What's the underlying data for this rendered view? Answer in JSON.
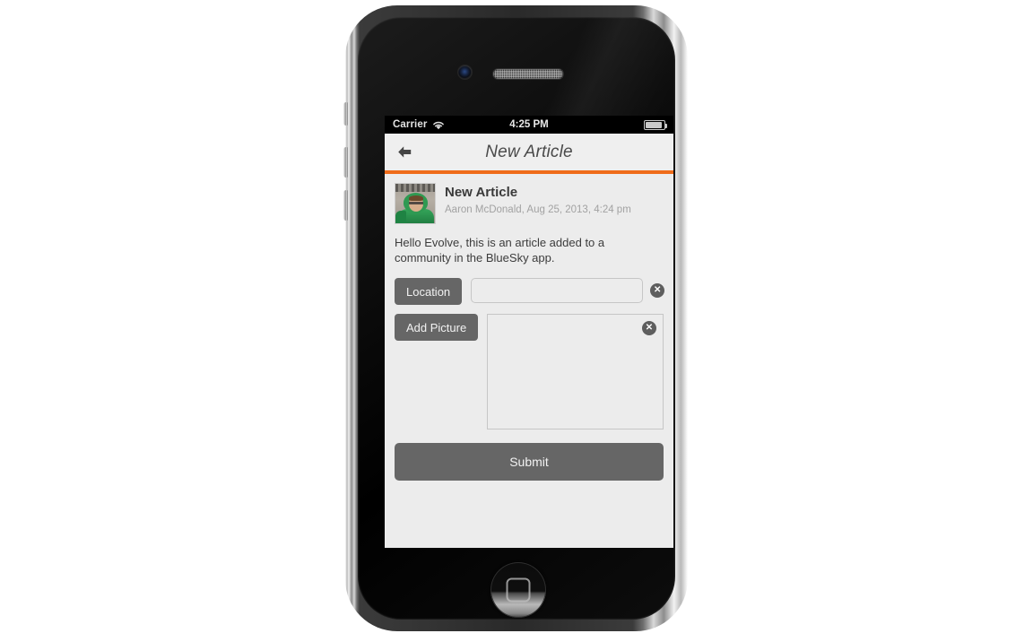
{
  "device": {
    "name": "iphone-4",
    "camera_icon": "front-camera",
    "speaker_icon": "earpiece-speaker",
    "home_button_icon": "home-button"
  },
  "status_bar": {
    "carrier": "Carrier",
    "wifi_icon": "wifi-icon",
    "time": "4:25 PM",
    "battery_icon": "battery-icon"
  },
  "nav_bar": {
    "back_icon": "back-arrow-icon",
    "back_glyph": "←",
    "title": "New Article",
    "accent_color": "#ef6c1a"
  },
  "article": {
    "avatar_alt": "Aaron McDonald avatar",
    "title": "New Article",
    "byline": "Aaron McDonald, Aug 25, 2013, 4:24 pm",
    "body": "Hello Evolve, this is an article added to a community in the BlueSky app."
  },
  "form": {
    "location": {
      "button_label": "Location",
      "value": "",
      "placeholder": "",
      "clear_glyph": "✕",
      "clear_icon": "clear-location-icon"
    },
    "picture": {
      "button_label": "Add Picture",
      "clear_glyph": "✕",
      "clear_icon": "clear-picture-icon"
    },
    "submit_label": "Submit"
  },
  "colors": {
    "accent_orange": "#ef6c1a",
    "button_gray": "#666666",
    "screen_bg": "#ececec",
    "nav_bg": "#efefef"
  }
}
